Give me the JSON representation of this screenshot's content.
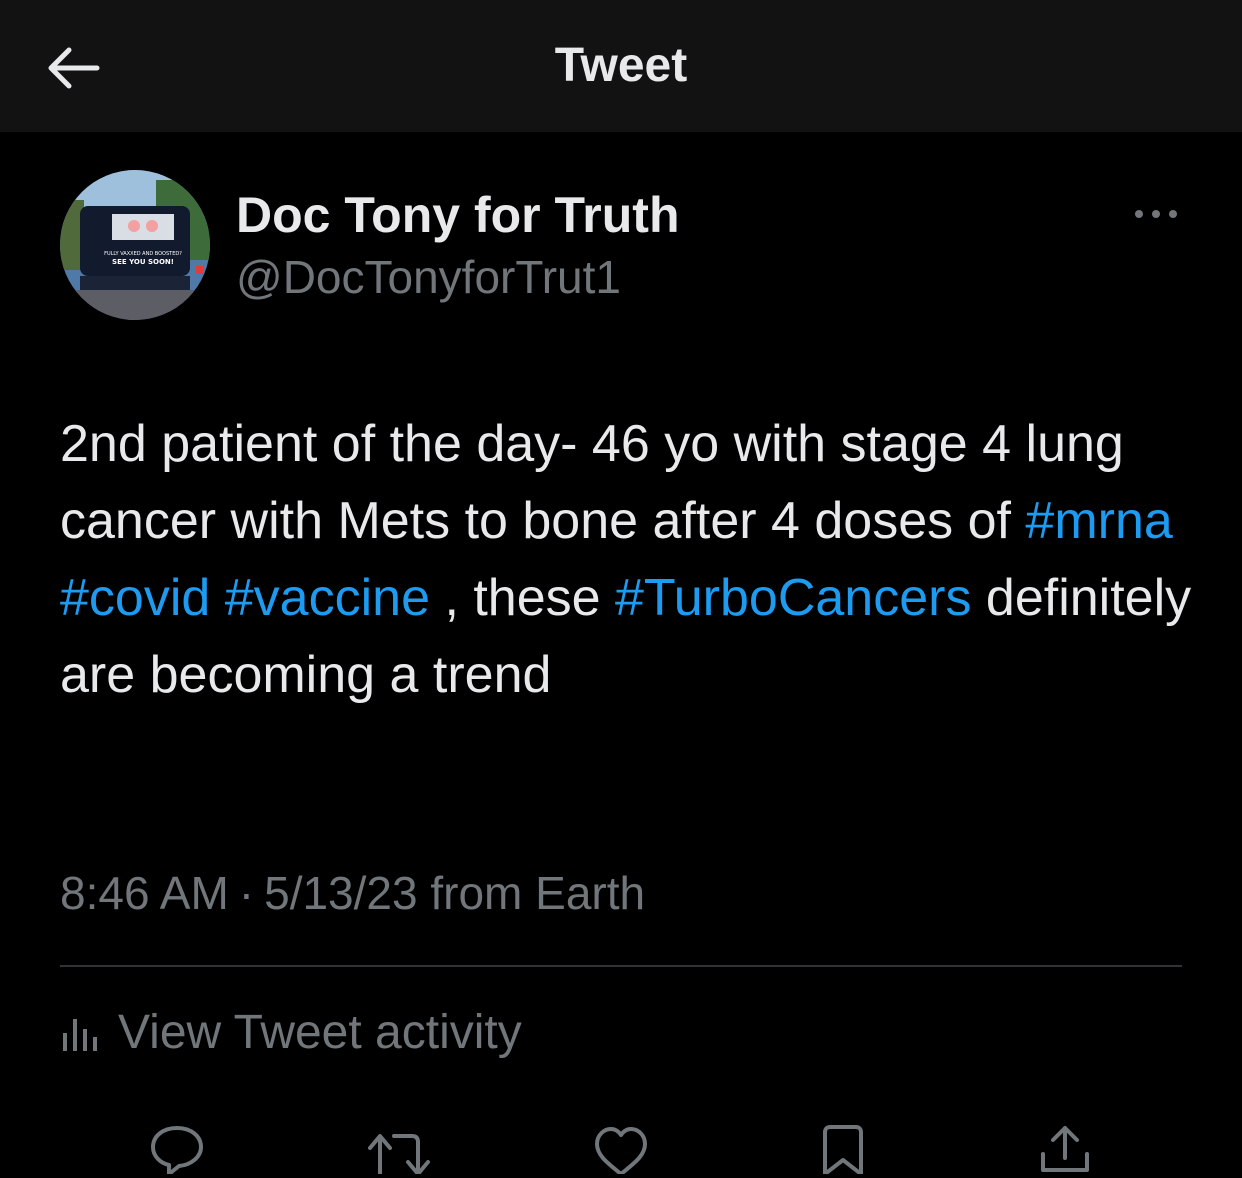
{
  "header": {
    "title": "Tweet",
    "back_icon": "arrow-left-icon"
  },
  "author": {
    "display_name": "Doc Tony for Truth",
    "handle": "@DocTonyforTrut1",
    "avatar_caption_line1": "FULLY VAXXED AND BOOSTED?",
    "avatar_caption_line2": "SEE YOU SOON!"
  },
  "tweet": {
    "text_1": "2nd patient of the day- 46 yo with stage 4 lung cancer with Mets to bone after 4 doses of ",
    "hashtag_1": "#mrna",
    "hashtag_2": "#covid",
    "hashtag_3": "#vaccine",
    "text_2": " , these ",
    "hashtag_4": "#TurboCancers",
    "text_3": " definitely are becoming a trend"
  },
  "meta": {
    "time": "8:46 AM",
    "separator": "·",
    "date": "5/13/23",
    "source": "from Earth"
  },
  "activity": {
    "label": "View Tweet activity",
    "icon": "bar-chart-icon"
  },
  "actions": [
    {
      "icon": "reply-icon"
    },
    {
      "icon": "retweet-icon"
    },
    {
      "icon": "like-icon"
    },
    {
      "icon": "bookmark-icon"
    },
    {
      "icon": "share-icon"
    }
  ],
  "colors": {
    "background": "#000000",
    "header_background": "#121212",
    "text_primary": "#e7e9ea",
    "text_secondary": "#71767b",
    "hashtag": "#1d9bf0",
    "divider": "#2f3336"
  }
}
